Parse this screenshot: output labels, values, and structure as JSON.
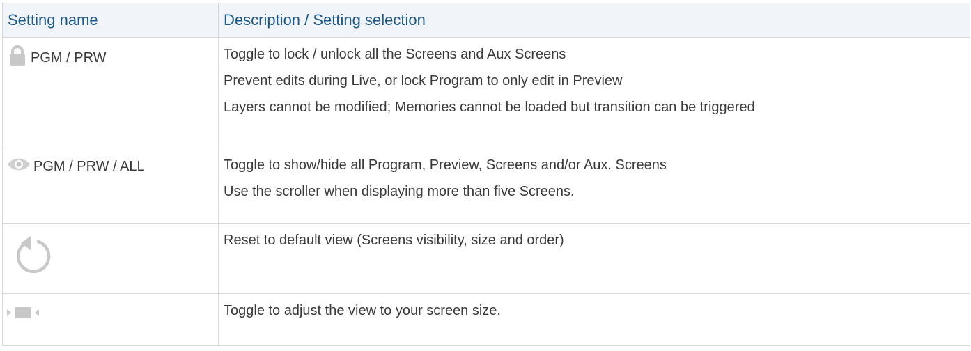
{
  "header": {
    "col_name": "Setting name",
    "col_desc": "Description / Setting selection"
  },
  "rows": [
    {
      "icon": "lock-icon",
      "name": "PGM / PRW",
      "lines": [
        "Toggle to lock / unlock all the Screens and Aux Screens",
        "Prevent edits during Live, or lock Program to only edit in Preview",
        "Layers cannot be modified; Memories cannot be loaded but transition can be triggered"
      ]
    },
    {
      "icon": "eye-icon",
      "name": "PGM / PRW / ALL",
      "lines": [
        "Toggle to show/hide all Program, Preview, Screens and/or Aux. Screens",
        "Use the scroller when displaying more than five Screens."
      ]
    },
    {
      "icon": "reset-icon",
      "name": "",
      "lines": [
        "Reset to default view (Screens visibility, size and order)"
      ]
    },
    {
      "icon": "fit-screen-icon",
      "name": "",
      "lines": [
        "Toggle to adjust the view to your screen size."
      ]
    }
  ],
  "colors": {
    "header_text": "#1d5a8c",
    "header_bg": "#f1f4f8",
    "icon_gray": "#c8c8c8"
  }
}
